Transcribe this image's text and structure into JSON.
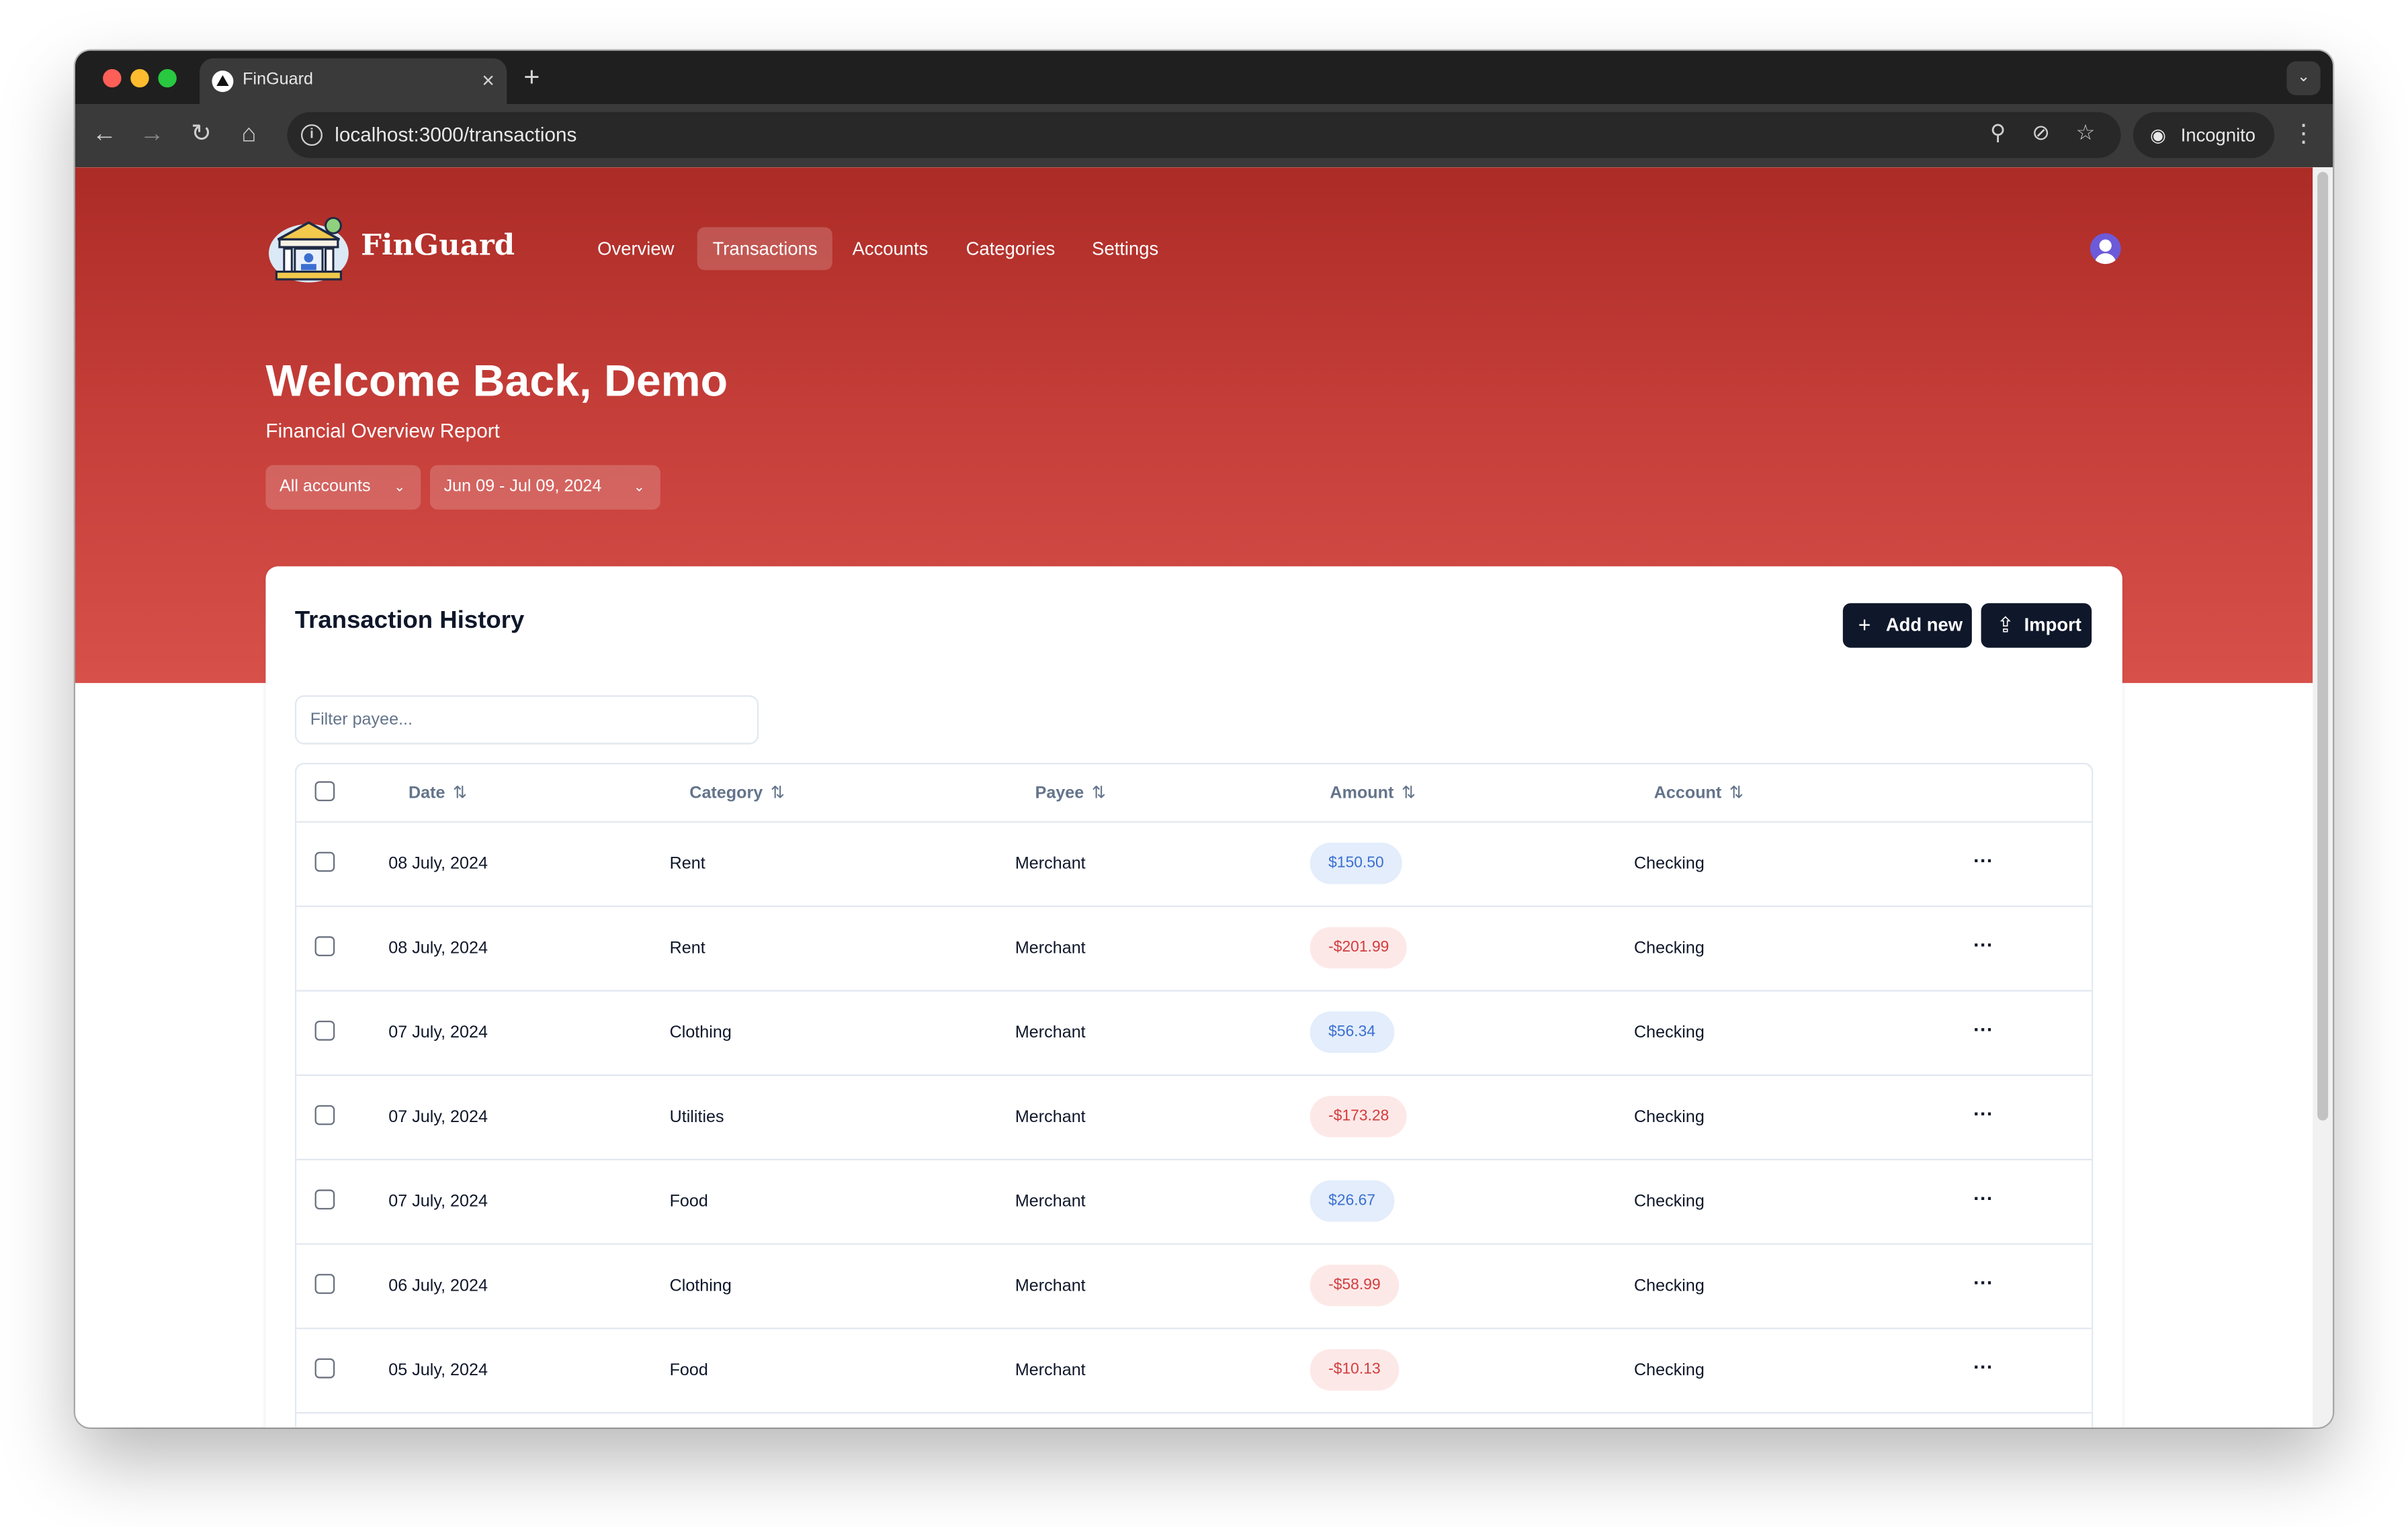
{
  "browser": {
    "tab_title": "FinGuard",
    "new_tab_symbol": "+",
    "tab_close_symbol": "×",
    "url": "localhost:3000/transactions",
    "incognito_label": "Incognito"
  },
  "app": {
    "brand": "FinGuard",
    "nav": [
      {
        "label": "Overview",
        "active": false
      },
      {
        "label": "Transactions",
        "active": true
      },
      {
        "label": "Accounts",
        "active": false
      },
      {
        "label": "Categories",
        "active": false
      },
      {
        "label": "Settings",
        "active": false
      }
    ],
    "colors": {
      "hero_top": "#ac2b26",
      "hero_bottom": "#d8504a",
      "primary_button": "#0f172a",
      "positive_amount": "#3b6fd0",
      "negative_amount": "#d33c3c"
    }
  },
  "header": {
    "welcome": "Welcome Back, Demo",
    "subtitle": "Financial Overview Report",
    "account_filter": "All accounts",
    "date_filter": "Jun 09 - Jul 09, 2024"
  },
  "card": {
    "title": "Transaction History",
    "add_new_label": "Add new",
    "import_label": "Import",
    "filter_placeholder": "Filter payee..."
  },
  "table": {
    "columns": [
      "Date",
      "Category",
      "Payee",
      "Amount",
      "Account"
    ],
    "rows": [
      {
        "date": "08 July, 2024",
        "category": "Rent",
        "payee": "Merchant",
        "amount": "$150.50",
        "sign": "pos",
        "account": "Checking"
      },
      {
        "date": "08 July, 2024",
        "category": "Rent",
        "payee": "Merchant",
        "amount": "-$201.99",
        "sign": "neg",
        "account": "Checking"
      },
      {
        "date": "07 July, 2024",
        "category": "Clothing",
        "payee": "Merchant",
        "amount": "$56.34",
        "sign": "pos",
        "account": "Checking"
      },
      {
        "date": "07 July, 2024",
        "category": "Utilities",
        "payee": "Merchant",
        "amount": "-$173.28",
        "sign": "neg",
        "account": "Checking"
      },
      {
        "date": "07 July, 2024",
        "category": "Food",
        "payee": "Merchant",
        "amount": "$26.67",
        "sign": "pos",
        "account": "Checking"
      },
      {
        "date": "06 July, 2024",
        "category": "Clothing",
        "payee": "Merchant",
        "amount": "-$58.99",
        "sign": "neg",
        "account": "Checking"
      },
      {
        "date": "05 July, 2024",
        "category": "Food",
        "payee": "Merchant",
        "amount": "-$10.13",
        "sign": "neg",
        "account": "Checking"
      }
    ]
  }
}
